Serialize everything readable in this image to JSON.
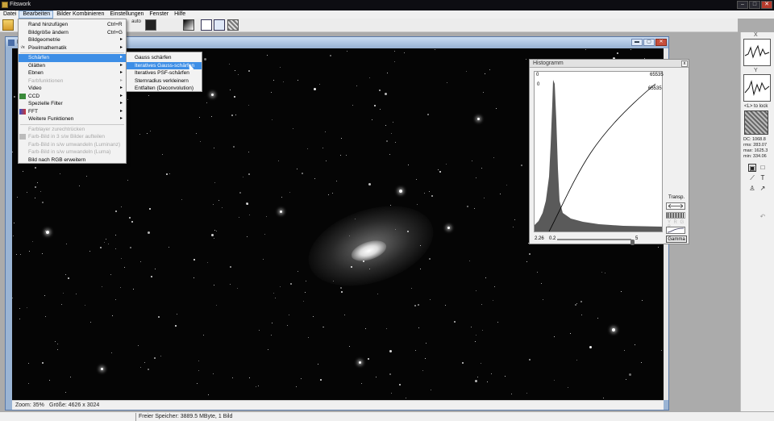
{
  "window": {
    "title": "Fitswork",
    "controls": [
      "‒",
      "□",
      "✕"
    ]
  },
  "menubar": [
    "Datei",
    "Bearbeiten",
    "Bilder Kombinieren",
    "Einstellungen",
    "Fenster",
    "Hilfe"
  ],
  "toolbar": {
    "auto_label": "auto"
  },
  "image_window": {
    "title": "D",
    "zoom": "Zoom: 35%",
    "size": "Größe: 4626 x 3024",
    "controls": [
      "▬",
      "▢",
      "✕"
    ]
  },
  "edit_menu": {
    "items": [
      {
        "label": "Rand hinzufügen",
        "shortcut": "Ctrl+R"
      },
      {
        "label": "Bildgröße ändern",
        "shortcut": "Ctrl+G"
      },
      {
        "label": "Bildgeometrie",
        "arrow": "▸"
      },
      {
        "label": "Pixelmathematik",
        "arrow": "▸",
        "icon": "√x"
      },
      {
        "label": "Schärfen",
        "arrow": "▸"
      },
      {
        "label": "Glätten",
        "arrow": "▸"
      },
      {
        "label": "Ebnen",
        "arrow": "▸"
      },
      {
        "label": "Farbfunktionen",
        "arrow": "▸"
      },
      {
        "label": "Video",
        "arrow": "▸"
      },
      {
        "label": "CCD",
        "arrow": "▸"
      },
      {
        "label": "Spezielle Filter",
        "arrow": "▸"
      },
      {
        "label": "FFT",
        "arrow": "▸"
      },
      {
        "label": "Weitere Funktionen",
        "arrow": "▸"
      },
      {
        "label": "Farblayer zurechtrücken"
      },
      {
        "label": "Farb-Bild in 3 s/w Bilder aufteilen"
      },
      {
        "label": "Farb-Bild in s/w umwandeln (Luminanz)"
      },
      {
        "label": "Farb-Bild in s/w umwandeln (Luma)"
      },
      {
        "label": "Bild nach RGB erweitern"
      }
    ]
  },
  "sharpen_menu": {
    "items": [
      "Gauss schärfen",
      "Iteratives Gauss-schärfen",
      "Iteratives PSF-schärfen",
      "Sternradius verkleinern",
      "Entfalten (Deconvolution)"
    ]
  },
  "histogram": {
    "title": "Histogramm",
    "close": "x",
    "left_top": "0",
    "zero_label": "0",
    "max_top": "65535",
    "max_curve": "65535",
    "low_value": "2.26",
    "gamma_value": "0.2",
    "gamma_max": "5",
    "gamma_slider_fraction": 0.7,
    "transp_label": "Transp.",
    "rgb_label": "Y R G B",
    "gamma_button": "Gamma"
  },
  "right_panel": {
    "x_label": "X",
    "y_label": "Y",
    "lock_label": "<L> to lock",
    "stats": [
      "DC: 1068.8",
      "rms: 283.07",
      "max: 1625.3",
      "min: 334.06"
    ]
  },
  "status": {
    "memory": "Freier Speicher: 3889.5 MByte, 1 Bild"
  },
  "colors": {
    "menu_highlight": "#3d8ee6",
    "title_bar": "#0d0d12",
    "image_window_frame": "#9ab4d4"
  }
}
